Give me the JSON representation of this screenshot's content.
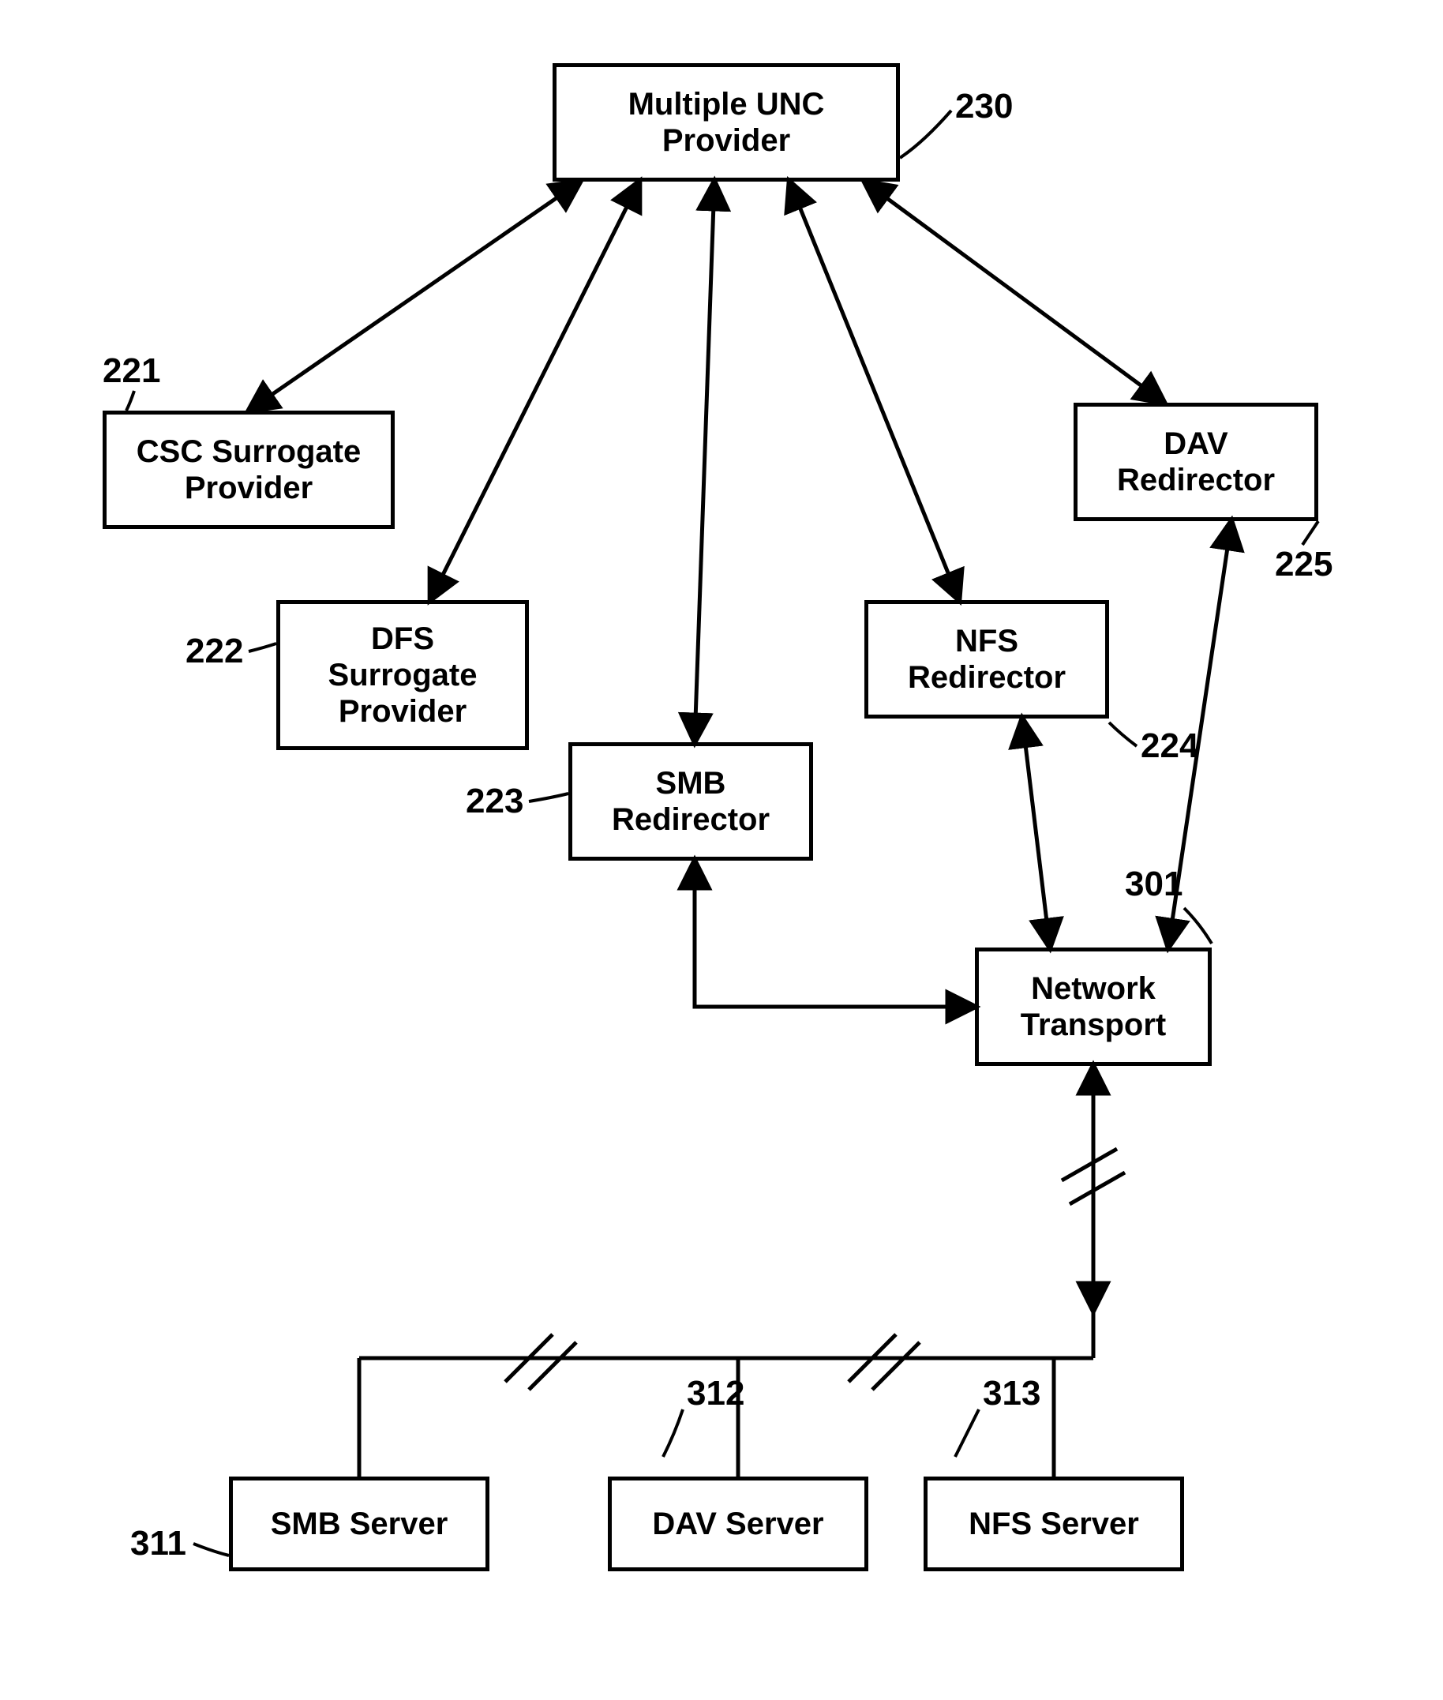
{
  "boxes": {
    "munc": {
      "text": "Multiple UNC\nProvider"
    },
    "csc": {
      "text": "CSC Surrogate\nProvider"
    },
    "dfs": {
      "text": "DFS\nSurrogate\nProvider"
    },
    "smb_redir": {
      "text": "SMB\nRedirector"
    },
    "nfs_redir": {
      "text": "NFS\nRedirector"
    },
    "dav_redir": {
      "text": "DAV\nRedirector"
    },
    "net_trans": {
      "text": "Network\nTransport"
    },
    "smb_srv": {
      "text": "SMB Server"
    },
    "dav_srv": {
      "text": "DAV Server"
    },
    "nfs_srv": {
      "text": "NFS Server"
    }
  },
  "labels": {
    "l230": "230",
    "l221": "221",
    "l222": "222",
    "l223": "223",
    "l224": "224",
    "l225": "225",
    "l301": "301",
    "l311": "311",
    "l312": "312",
    "l313": "313"
  }
}
